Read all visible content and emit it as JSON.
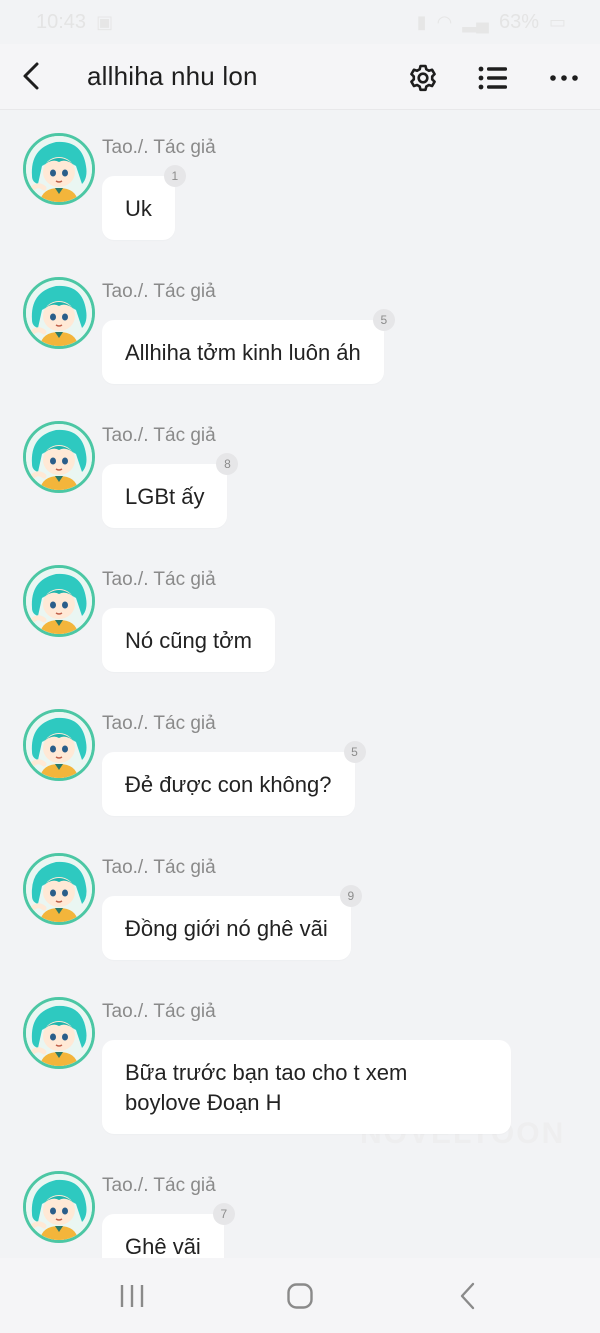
{
  "status_bar": {
    "time": "10:43",
    "battery": "63%"
  },
  "header": {
    "title": "allhiha nhu lon",
    "back_icon": "chevron-left-icon",
    "settings_icon": "gear-icon",
    "list_icon": "list-icon",
    "more_icon": "more-horizontal-icon"
  },
  "messages": [
    {
      "author": "Tao./. Tác giả",
      "text": "Uk",
      "count": "1"
    },
    {
      "author": "Tao./. Tác giả",
      "text": "Allhiha tởm kinh luôn áh",
      "count": "5"
    },
    {
      "author": "Tao./. Tác giả",
      "text": "LGBt ấy",
      "count": "8"
    },
    {
      "author": "Tao./. Tác giả",
      "text": "Nó cũng tởm",
      "count": ""
    },
    {
      "author": "Tao./. Tác giả",
      "text": "Đẻ được con không?",
      "count": "5"
    },
    {
      "author": "Tao./. Tác giả",
      "text": "Đồng giới nó ghê vãi",
      "count": "9"
    },
    {
      "author": "Tao./. Tác giả",
      "text": "Bữa trước bạn tao cho t xem boylove Đoạn H",
      "count": ""
    },
    {
      "author": "Tao./. Tác giả",
      "text": "Ghê vãi",
      "count": "7"
    }
  ],
  "watermark": "NOVELTOON",
  "colors": {
    "background": "#f2f3f5",
    "bubble": "#ffffff",
    "avatar_ring": "#4cc7a4"
  }
}
